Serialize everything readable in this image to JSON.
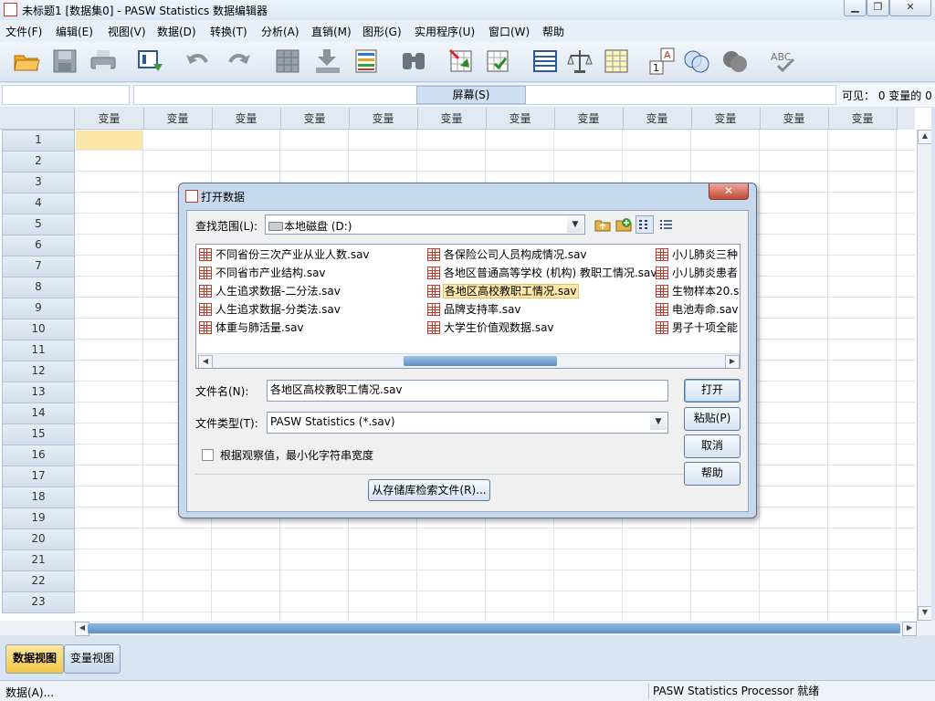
{
  "window": {
    "title": "未标题1 [数据集0] - PASW Statistics 数据编辑器",
    "controls": [
      "▁",
      "❐",
      "✕"
    ]
  },
  "menu": [
    "文件(F)",
    "编辑(E)",
    "视图(V)",
    "数据(D)",
    "转换(T)",
    "分析(A)",
    "直销(M)",
    "图形(G)",
    "实用程序(U)",
    "窗口(W)",
    "帮助"
  ],
  "toolbar": {
    "icons": [
      "open-folder-icon",
      "save-icon",
      "print-icon",
      "dialog-recall-icon",
      "undo-icon",
      "redo-icon",
      "goto-case-icon",
      "goto-variable-icon",
      "variables-icon",
      "find-icon",
      "insert-cases-icon",
      "insert-variable-icon",
      "split-file-icon",
      "weight-cases-icon",
      "select-cases-icon",
      "value-labels-icon",
      "use-sets-icon",
      "show-all-variables-icon",
      "spell-check-icon"
    ]
  },
  "cell_editor": {
    "screen_button": "屏幕(S)",
    "visible": "可见：  0 变量的 0"
  },
  "grid": {
    "column_header": "变量",
    "columns": 12,
    "rows": [
      "1",
      "2",
      "3",
      "4",
      "5",
      "6",
      "7",
      "8",
      "9",
      "10",
      "11",
      "12",
      "13",
      "14",
      "15",
      "16",
      "17",
      "18",
      "19",
      "20",
      "21",
      "22",
      "23"
    ]
  },
  "tabs": {
    "data_view": "数据视图",
    "variable_view": "变量视图"
  },
  "status": {
    "left": "数据(A)...",
    "right": "PASW Statistics Processor 就绪"
  },
  "dialog": {
    "title": "打开数据",
    "close": "✕",
    "look_in_label": "查找范围(L):",
    "look_in_value": "本地磁盘 (D:)",
    "files": {
      "col1": [
        "不同省份三次产业从业人数.sav",
        "不同省市产业结构.sav",
        "人生追求数据-二分法.sav",
        "人生追求数据-分类法.sav",
        "体重与肺活量.sav"
      ],
      "col2": [
        "各保险公司人员构成情况.sav",
        "各地区普通高等学校 (机构) 教职工情况.sav",
        "各地区高校教职工情况.sav",
        "品牌支持率.sav",
        "大学生价值观数据.sav"
      ],
      "col3": [
        "小儿肺炎三种",
        "小儿肺炎患者",
        "生物样本20.s",
        "电池寿命.sav",
        "男子十项全能"
      ]
    },
    "selected_file": "各地区高校教职工情况.sav",
    "filename_label": "文件名(N):",
    "filename_value": "各地区高校教职工情况.sav",
    "filetype_label": "文件类型(T):",
    "filetype_value": "PASW Statistics (*.sav)",
    "checkbox_label": "根据观察值，最小化字符串宽度",
    "buttons": {
      "open": "打开",
      "paste": "粘贴(P)",
      "cancel": "取消",
      "help": "帮助"
    },
    "repository_button": "从存储库检索文件(R)..."
  }
}
